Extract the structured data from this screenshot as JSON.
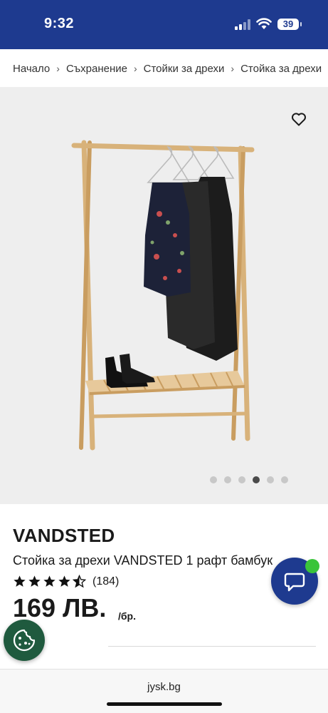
{
  "status_bar": {
    "time": "9:32",
    "battery": "39"
  },
  "breadcrumb": {
    "items": [
      "Начало",
      "Съхранение",
      "Стойки за дрехи",
      "Стойка за дрехи"
    ],
    "separator": "›"
  },
  "gallery": {
    "image_count": 6,
    "active_index": 3,
    "favorite_icon": "heart-outline-icon"
  },
  "product": {
    "brand": "VANDSTED",
    "name": "Стойка за дрехи VANDSTED 1 рафт бамбук",
    "rating": 4.5,
    "rating_count": "(184)",
    "price": "169 ЛВ.",
    "unit": "/бр."
  },
  "floating": {
    "chat_icon": "chat-bubble-icon",
    "cookie_icon": "cookie-icon"
  },
  "browser": {
    "url": "jysk.bg"
  },
  "colors": {
    "brand_blue": "#1e3a8f",
    "cookie_green": "#1f5a3e",
    "badge_green": "#3ac43a"
  }
}
